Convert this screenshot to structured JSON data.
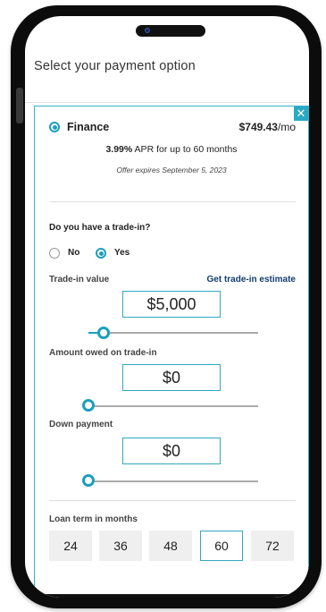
{
  "page": {
    "title": "Select your payment option"
  },
  "finance": {
    "label": "Finance",
    "price": "$749.43",
    "price_suffix": "/mo",
    "apr_rate": "3.99%",
    "apr_text": " APR for up to 60 months",
    "expires": "Offer expires September 5, 2023"
  },
  "trade_in": {
    "question": "Do you have a trade-in?",
    "no_label": "No",
    "yes_label": "Yes",
    "selected": "Yes",
    "value_label": "Trade-in value",
    "estimate_link": "Get trade-in estimate",
    "value": "$5,000",
    "value_slider": 0.09,
    "owed_label": "Amount owed on trade-in",
    "owed": "$0",
    "owed_slider": 0
  },
  "down_payment": {
    "label": "Down payment",
    "value": "$0",
    "slider": 0
  },
  "loan_term": {
    "label": "Loan term in months",
    "options": [
      "24",
      "36",
      "48",
      "60",
      "72"
    ],
    "selected": "60"
  },
  "colors": {
    "accent": "#1b9fc0",
    "border": "#31a8c0"
  },
  "icons": {
    "close": "close-icon"
  }
}
